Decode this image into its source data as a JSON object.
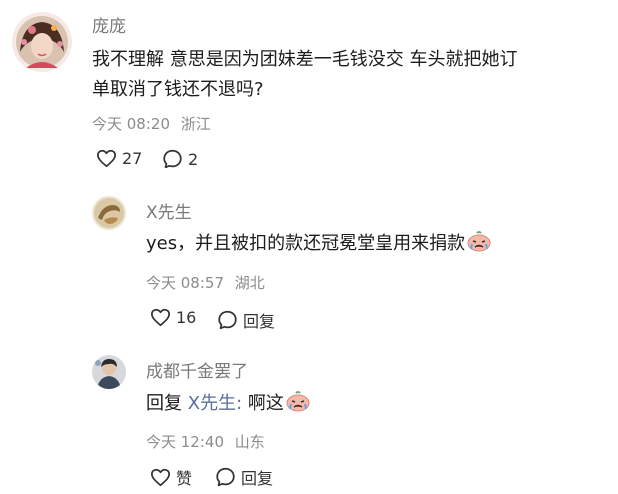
{
  "comments": [
    {
      "author": "庞庞",
      "text_line1": "我不理解 意思是因为团妹差一毛钱没交 车头就把她订",
      "text_line2": "单取消了钱还不退吗?",
      "time": "今天 08:20",
      "location": "浙江",
      "likes": "27",
      "replies": "2"
    },
    {
      "author": "X先生",
      "text": "yes，并且被扣的款还冠冕堂皇用来捐款",
      "time": "今天 08:57",
      "location": "湖北",
      "likes": "16",
      "reply_label": "回复"
    },
    {
      "author": "成都千金罢了",
      "reply_prefix": "回复",
      "mention": "X先生:",
      "text": "啊这",
      "time": "今天 12:40",
      "location": "山东",
      "likes": "赞",
      "reply_label": "回复"
    }
  ],
  "colors": {
    "name": "#7a7a7a",
    "meta": "#8c8c8c",
    "mention": "#5a6f9a"
  },
  "icons": [
    "heart-icon",
    "comment-bubble-icon",
    "crying-emoji-icon"
  ]
}
